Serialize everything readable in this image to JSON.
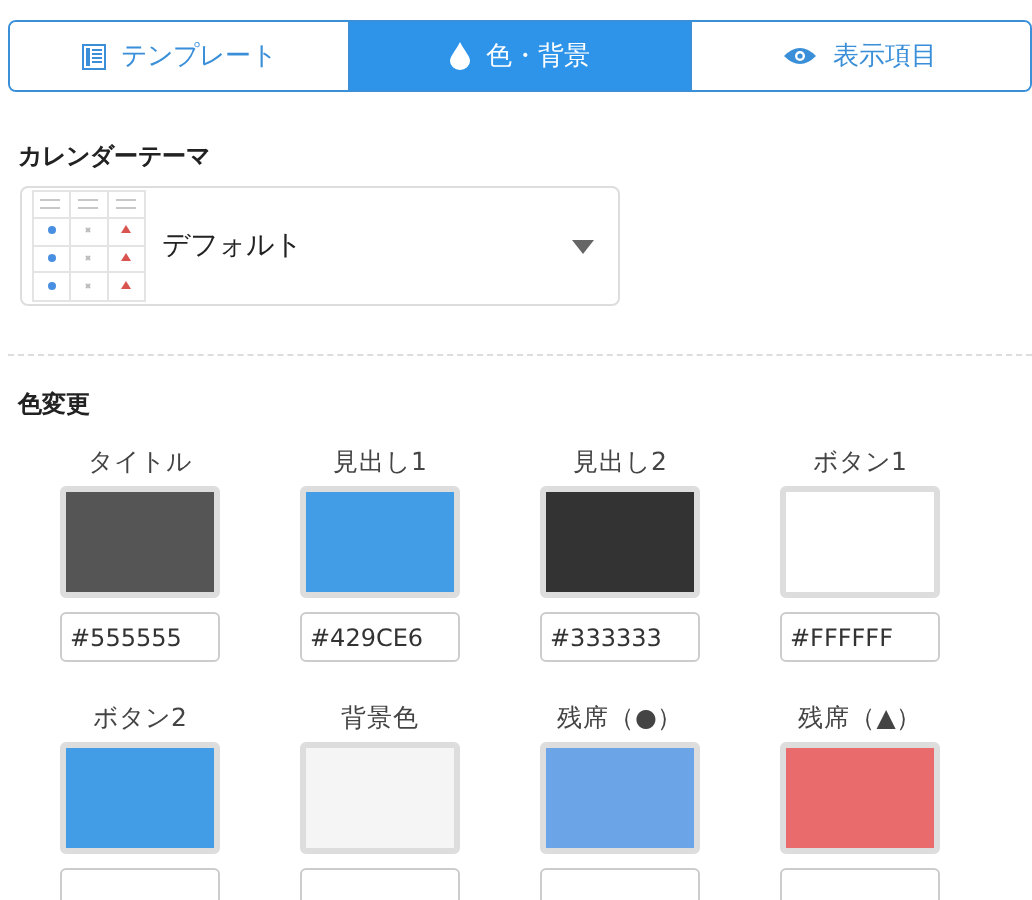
{
  "tabs": [
    {
      "label": "テンプレート",
      "kind": "list",
      "selected": false
    },
    {
      "label": "色・背景",
      "kind": "drop",
      "selected": true
    },
    {
      "label": "表示項目",
      "kind": "eye",
      "selected": false
    }
  ],
  "calendar_theme": {
    "label": "カレンダーテーマ",
    "value": "デフォルト"
  },
  "color_change": {
    "heading": "色変更",
    "items": [
      {
        "label": "タイトル",
        "color": "#555555",
        "value": "#555555"
      },
      {
        "label": "見出し1",
        "color": "#429ce6",
        "value": "#429CE6"
      },
      {
        "label": "見出し2",
        "color": "#333333",
        "value": "#333333"
      },
      {
        "label": "ボタン1",
        "color": "#ffffff",
        "value": "#FFFFFF"
      },
      {
        "label": "ボタン2",
        "color": "#429ce6"
      },
      {
        "label": "背景色",
        "color": "#f5f5f5"
      },
      {
        "label": "残席（●）",
        "color": "#6ba5e7"
      },
      {
        "label": "残席（▲）",
        "color": "#e96b6b"
      }
    ]
  }
}
